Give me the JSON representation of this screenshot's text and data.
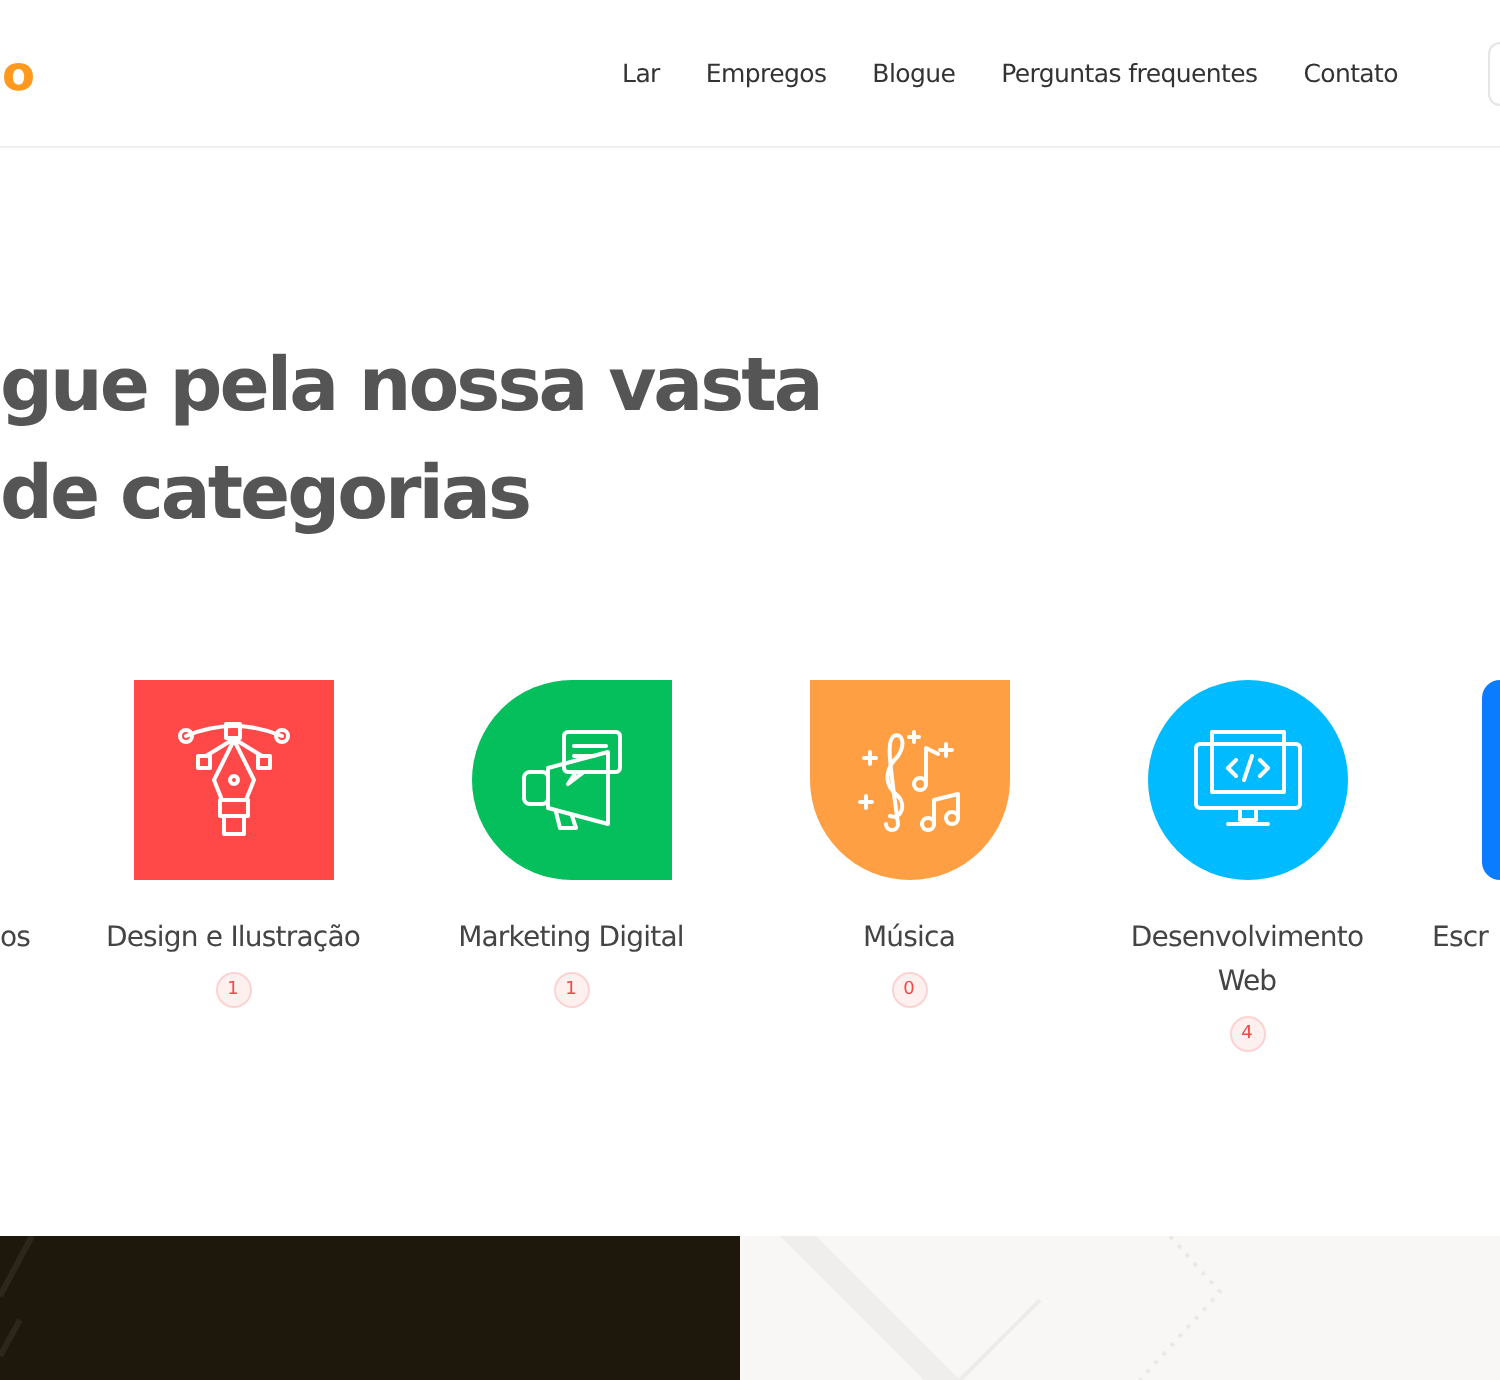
{
  "header": {
    "logo": "o",
    "nav": [
      {
        "label": "Lar"
      },
      {
        "label": "Empregos"
      },
      {
        "label": "Blogue"
      },
      {
        "label": "Perguntas frequentes"
      },
      {
        "label": "Contato"
      }
    ]
  },
  "heading": {
    "lines": [
      "gue pela nossa vasta",
      "de categorias"
    ]
  },
  "categories": [
    {
      "kind": "cut_left",
      "name": "os"
    },
    {
      "kind": "full",
      "name": "Design e Ilustração",
      "count": "1",
      "color": "#ff4848"
    },
    {
      "kind": "full",
      "name": "Marketing Digital",
      "count": "1",
      "color": "#04bf5b"
    },
    {
      "kind": "full",
      "name": "Música",
      "count": "0",
      "color": "#ff9f43"
    },
    {
      "kind": "full",
      "name": "Desenvolvimento Web",
      "count": "4",
      "color": "#00bbff"
    },
    {
      "kind": "cut_right",
      "name": "Escr",
      "color": "#0a7cff"
    }
  ]
}
